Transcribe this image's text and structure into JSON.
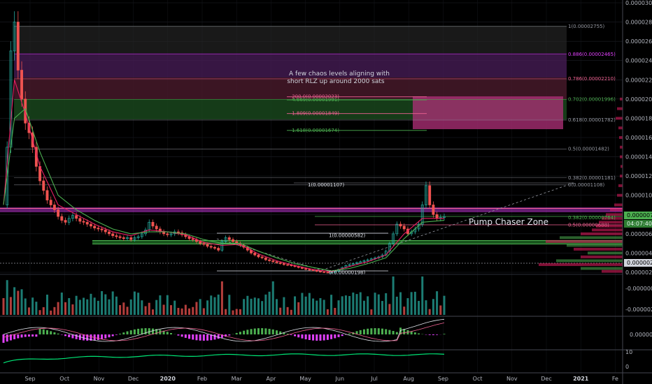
{
  "chart_data": {
    "type": "candlestick",
    "price_axis": {
      "ticks": [
        "0.00003000",
        "0.00002800",
        "0.00002600",
        "0.00002400",
        "0.00002200",
        "0.00002000",
        "0.00001800",
        "0.00001600",
        "0.00001400",
        "0.00001200",
        "0.00001000",
        "0.00000800",
        "0.00000600",
        "0.00000400",
        "0.00000200"
      ],
      "tick_values": [
        3000,
        2800,
        2600,
        2400,
        2200,
        2000,
        1800,
        1600,
        1400,
        1200,
        1000,
        800,
        600,
        400,
        200
      ],
      "range": [
        200,
        3000
      ],
      "current_price_tag": "0.00000779",
      "countdown_tag": "04:07:40",
      "support_tag": "0.00000275",
      "current_price": 779,
      "support_price": 275
    },
    "volume_axis": {
      "ticks": [
        "-0.00000000",
        "-0.00000200"
      ]
    },
    "oscillator_axis": {
      "ticks": [
        "0.00000000"
      ]
    },
    "rsi_axis": {
      "ticks": [
        "10",
        "0"
      ]
    },
    "time_axis": {
      "labels": [
        "Sep",
        "Oct",
        "Nov",
        "Dec",
        "2020",
        "Feb",
        "Mar",
        "Apr",
        "May",
        "Jun",
        "Jul",
        "Aug",
        "Sep",
        "Oct",
        "Nov",
        "Dec",
        "2021",
        "Fe"
      ],
      "bold": [
        "2020",
        "2021"
      ]
    },
    "fib_extension_levels": [
      {
        "label": "1(0.00002755)",
        "value": 2755,
        "color": "#9598a1"
      },
      {
        "label": "0.886(0.00002465)",
        "value": 2465,
        "color": "#e040fb"
      },
      {
        "label": "0.786(0.00002210)",
        "value": 2210,
        "color": "#f06292"
      },
      {
        "label": "0.702(0.00001996)",
        "value": 1996,
        "color": "#4caf50"
      },
      {
        "label": "0.618(0.00001782)",
        "value": 1782,
        "color": "#9598a1"
      },
      {
        "label": "0.5(0.00001482)",
        "value": 1482,
        "color": "#9598a1"
      },
      {
        "label": "0.382(0.00001181)",
        "value": 1181,
        "color": "#9598a1"
      },
      {
        "label": "0(0.00001108)",
        "value": 1108,
        "color": "#9598a1"
      },
      {
        "label": "0.382(0.00000764)",
        "value": 764,
        "color": "#4caf50"
      },
      {
        "label": "0.5(0.00000688)",
        "value": 688,
        "color": "#f06292"
      }
    ],
    "chaos_levels": [
      {
        "label": "200.0(0.00002023)",
        "value": 2023,
        "color": "#f06292"
      },
      {
        "label": "4.669(0.00001991)",
        "value": 1991,
        "color": "#4caf50"
      },
      {
        "label": "1.809(0.00001849)",
        "value": 1849,
        "color": "#f06292"
      },
      {
        "label": "1.618(0.00001674)",
        "value": 1674,
        "color": "#4caf50"
      }
    ],
    "swing_labels": [
      {
        "label": "1(0.00001107)",
        "value": 1107
      },
      {
        "label": "1(0.00000582)",
        "value": 582
      },
      {
        "label": "0(0.00000198)",
        "value": 198
      }
    ],
    "annotations": {
      "chaos_note_line1": "A few chaos levels aligning with",
      "chaos_note_line2": "short RLZ up around 2000 sats",
      "zone_label": "Pump Chaser Zone"
    },
    "series": [
      {
        "name": "price",
        "color": "#26a69a",
        "points": [
          [
            0,
            900
          ],
          [
            1,
            1500
          ],
          [
            2,
            2500
          ],
          [
            3,
            2800
          ],
          [
            4,
            2300
          ],
          [
            5,
            2000
          ],
          [
            6,
            1750
          ],
          [
            7,
            1650
          ],
          [
            8,
            1500
          ],
          [
            9,
            1300
          ],
          [
            10,
            1150
          ],
          [
            11,
            1050
          ],
          [
            12,
            950
          ],
          [
            13,
            900
          ],
          [
            14,
            850
          ],
          [
            15,
            780
          ],
          [
            16,
            740
          ],
          [
            17,
            720
          ],
          [
            18,
            760
          ],
          [
            19,
            790
          ],
          [
            20,
            760
          ],
          [
            21,
            730
          ],
          [
            22,
            720
          ],
          [
            23,
            700
          ],
          [
            24,
            680
          ],
          [
            25,
            660
          ],
          [
            26,
            650
          ],
          [
            27,
            640
          ],
          [
            28,
            620
          ],
          [
            29,
            600
          ],
          [
            30,
            580
          ],
          [
            31,
            570
          ],
          [
            32,
            560
          ],
          [
            33,
            550
          ],
          [
            34,
            560
          ],
          [
            35,
            540
          ],
          [
            36,
            560
          ],
          [
            37,
            570
          ],
          [
            38,
            600
          ],
          [
            39,
            640
          ],
          [
            40,
            720
          ],
          [
            41,
            680
          ],
          [
            42,
            650
          ],
          [
            43,
            620
          ],
          [
            44,
            600
          ],
          [
            45,
            590
          ],
          [
            46,
            600
          ],
          [
            47,
            620
          ],
          [
            48,
            610
          ],
          [
            49,
            590
          ],
          [
            50,
            570
          ],
          [
            51,
            550
          ],
          [
            52,
            540
          ],
          [
            53,
            520
          ],
          [
            54,
            500
          ],
          [
            55,
            490
          ],
          [
            56,
            470
          ],
          [
            57,
            460
          ],
          [
            58,
            450
          ],
          [
            59,
            430
          ],
          [
            60,
            520
          ],
          [
            61,
            560
          ],
          [
            62,
            540
          ],
          [
            63,
            520
          ],
          [
            64,
            500
          ],
          [
            65,
            480
          ],
          [
            66,
            460
          ],
          [
            67,
            430
          ],
          [
            68,
            400
          ],
          [
            69,
            380
          ],
          [
            70,
            360
          ],
          [
            71,
            350
          ],
          [
            72,
            330
          ],
          [
            73,
            320
          ],
          [
            74,
            310
          ],
          [
            75,
            300
          ],
          [
            76,
            290
          ],
          [
            77,
            280
          ],
          [
            78,
            275
          ],
          [
            79,
            270
          ],
          [
            80,
            260
          ],
          [
            81,
            250
          ],
          [
            82,
            240
          ],
          [
            83,
            230
          ],
          [
            84,
            225
          ],
          [
            85,
            220
          ],
          [
            86,
            210
          ],
          [
            87,
            205
          ],
          [
            88,
            200
          ],
          [
            89,
            198
          ],
          [
            90,
            200
          ],
          [
            91,
            210
          ],
          [
            92,
            230
          ],
          [
            93,
            250
          ],
          [
            94,
            270
          ],
          [
            95,
            280
          ],
          [
            96,
            290
          ],
          [
            97,
            300
          ],
          [
            98,
            310
          ],
          [
            99,
            320
          ],
          [
            100,
            330
          ],
          [
            101,
            340
          ],
          [
            102,
            350
          ],
          [
            103,
            360
          ],
          [
            104,
            380
          ],
          [
            105,
            420
          ],
          [
            106,
            500
          ],
          [
            107,
            600
          ],
          [
            108,
            700
          ],
          [
            109,
            680
          ],
          [
            110,
            650
          ],
          [
            111,
            600
          ],
          [
            112,
            620
          ],
          [
            113,
            650
          ],
          [
            114,
            700
          ],
          [
            115,
            900
          ],
          [
            116,
            1100
          ],
          [
            117,
            900
          ],
          [
            118,
            800
          ],
          [
            119,
            760
          ],
          [
            120,
            770
          ],
          [
            121,
            779
          ]
        ]
      },
      {
        "name": "ema_fast",
        "color": "#e91e63",
        "points": [
          [
            0,
            900
          ],
          [
            3,
            2200
          ],
          [
            6,
            1850
          ],
          [
            10,
            1300
          ],
          [
            15,
            900
          ],
          [
            20,
            800
          ],
          [
            25,
            700
          ],
          [
            30,
            620
          ],
          [
            35,
            580
          ],
          [
            40,
            640
          ],
          [
            45,
            620
          ],
          [
            50,
            590
          ],
          [
            55,
            510
          ],
          [
            60,
            480
          ],
          [
            65,
            490
          ],
          [
            70,
            390
          ],
          [
            75,
            320
          ],
          [
            80,
            270
          ],
          [
            85,
            230
          ],
          [
            90,
            205
          ],
          [
            95,
            260
          ],
          [
            100,
            310
          ],
          [
            105,
            380
          ],
          [
            110,
            600
          ],
          [
            115,
            760
          ],
          [
            121,
            760
          ]
        ]
      },
      {
        "name": "ema_slow",
        "color": "#4caf50",
        "points": [
          [
            0,
            900
          ],
          [
            3,
            1800
          ],
          [
            6,
            1900
          ],
          [
            10,
            1450
          ],
          [
            15,
            1000
          ],
          [
            20,
            850
          ],
          [
            25,
            740
          ],
          [
            30,
            650
          ],
          [
            35,
            600
          ],
          [
            40,
            620
          ],
          [
            45,
            620
          ],
          [
            50,
            600
          ],
          [
            55,
            540
          ],
          [
            60,
            500
          ],
          [
            65,
            500
          ],
          [
            70,
            420
          ],
          [
            75,
            350
          ],
          [
            80,
            290
          ],
          [
            85,
            250
          ],
          [
            90,
            215
          ],
          [
            95,
            240
          ],
          [
            100,
            290
          ],
          [
            105,
            350
          ],
          [
            110,
            550
          ],
          [
            115,
            720
          ],
          [
            121,
            740
          ]
        ]
      }
    ]
  }
}
